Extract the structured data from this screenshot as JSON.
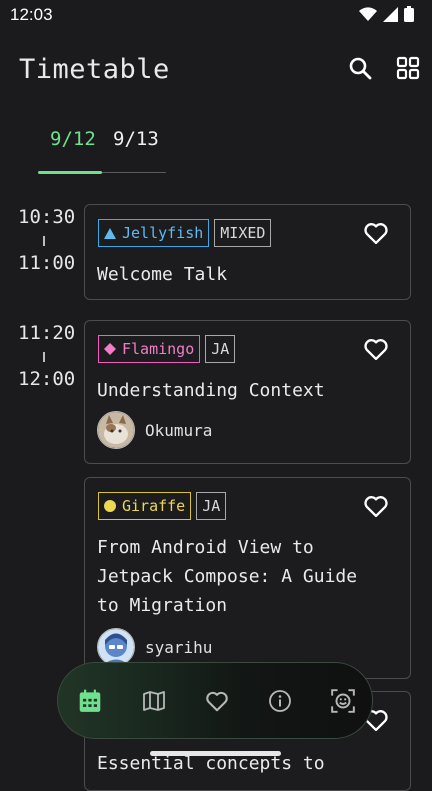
{
  "status": {
    "time": "12:03"
  },
  "header": {
    "title": "Timetable"
  },
  "tabs": [
    {
      "label": "9/12"
    },
    {
      "label": "9/13"
    }
  ],
  "colors": {
    "accent": "#6fe08d",
    "jellyfish": "#3fa9e6",
    "flamingo": "#f05fbf",
    "giraffe": "#e8d33f"
  },
  "slots": [
    {
      "start": "10:30",
      "end": "11:00"
    },
    {
      "start": "11:20",
      "end": "12:00"
    }
  ],
  "sessions": [
    {
      "room": "Jellyfish",
      "room_icon": "triangle-icon",
      "lang": "MIXED",
      "title": "Welcome Talk"
    },
    {
      "room": "Flamingo",
      "room_icon": "diamond-icon",
      "lang": "JA",
      "title": "Understanding Context",
      "speaker": "Okumura"
    },
    {
      "room": "Giraffe",
      "room_icon": "circle-icon",
      "lang": "JA",
      "title_lines": [
        "From Android View to",
        "Jetpack Compose: A Guide",
        "to Migration"
      ],
      "speaker": "syarihu"
    },
    {
      "title": "Essential concepts to"
    }
  ],
  "nav": [
    "calendar-icon",
    "map-icon",
    "heart-icon",
    "info-icon",
    "profile-icon"
  ]
}
